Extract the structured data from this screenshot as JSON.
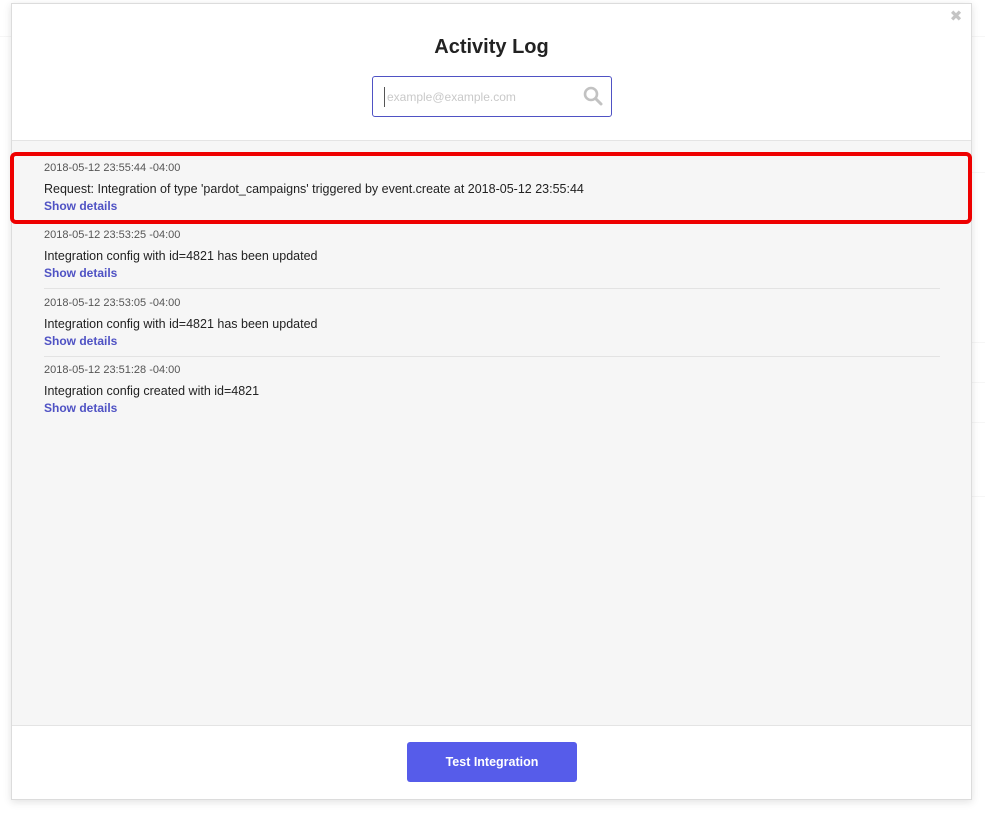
{
  "modal": {
    "title": "Activity Log",
    "close_icon": "close-icon"
  },
  "search": {
    "placeholder": "example@example.com",
    "value": "",
    "icon": "search-icon"
  },
  "entries": [
    {
      "timestamp": "2018-05-12 23:55:44 -04:00",
      "message": "Request: Integration of type 'pardot_campaigns' triggered by event.create at 2018-05-12 23:55:44",
      "link": "Show details",
      "highlighted": true
    },
    {
      "timestamp": "2018-05-12 23:53:25 -04:00",
      "message": "Integration config with id=4821 has been updated",
      "link": "Show details",
      "highlighted": false
    },
    {
      "timestamp": "2018-05-12 23:53:05 -04:00",
      "message": "Integration config with id=4821 has been updated",
      "link": "Show details",
      "highlighted": false
    },
    {
      "timestamp": "2018-05-12 23:51:28 -04:00",
      "message": "Integration config created with id=4821",
      "link": "Show details",
      "highlighted": false
    }
  ],
  "footer": {
    "button_label": "Test Integration"
  },
  "colors": {
    "accent": "#565cea",
    "link": "#4f52c4",
    "highlight": "#ee0000",
    "log_background": "#f6f6f6"
  }
}
